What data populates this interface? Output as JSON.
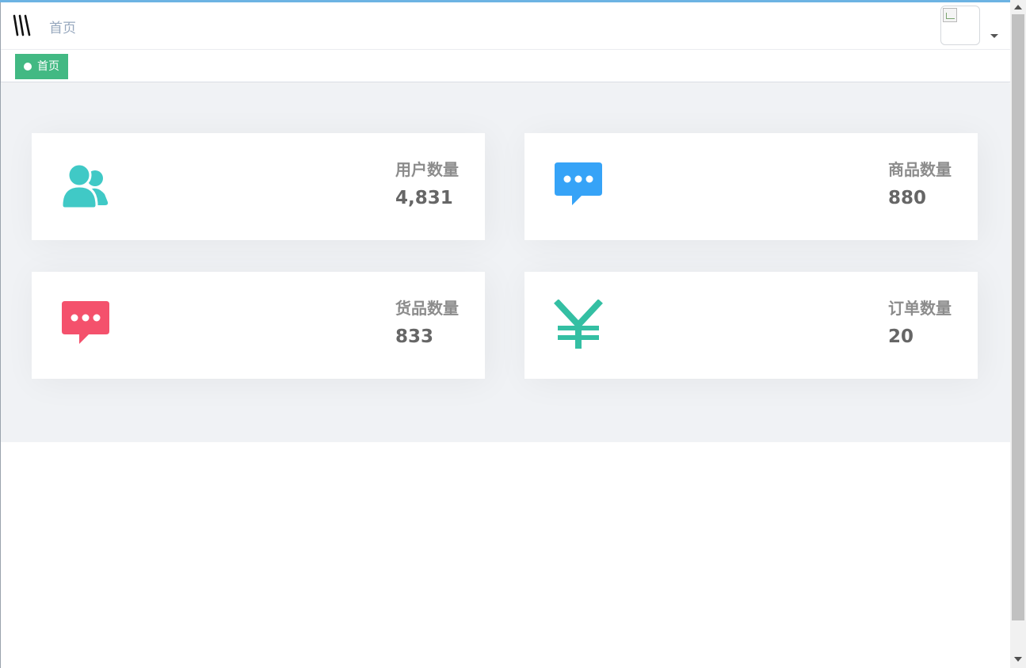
{
  "navbar": {
    "breadcrumb": "首页"
  },
  "tags": [
    {
      "label": "首页",
      "active": true
    }
  ],
  "cards": [
    {
      "label": "用户数量",
      "value": "4,831",
      "icon": "users-icon",
      "color": "#40c9c6"
    },
    {
      "label": "商品数量",
      "value": "880",
      "icon": "message-icon",
      "color": "#36a3f7"
    },
    {
      "label": "货品数量",
      "value": "833",
      "icon": "message-icon",
      "color": "#f4516c"
    },
    {
      "label": "订单数量",
      "value": "20",
      "icon": "yen-icon",
      "color": "#34bfa3"
    }
  ],
  "theme": {
    "accent": "#42b983",
    "top_accent": "#6cb3e3",
    "background": "#f0f2f5"
  }
}
